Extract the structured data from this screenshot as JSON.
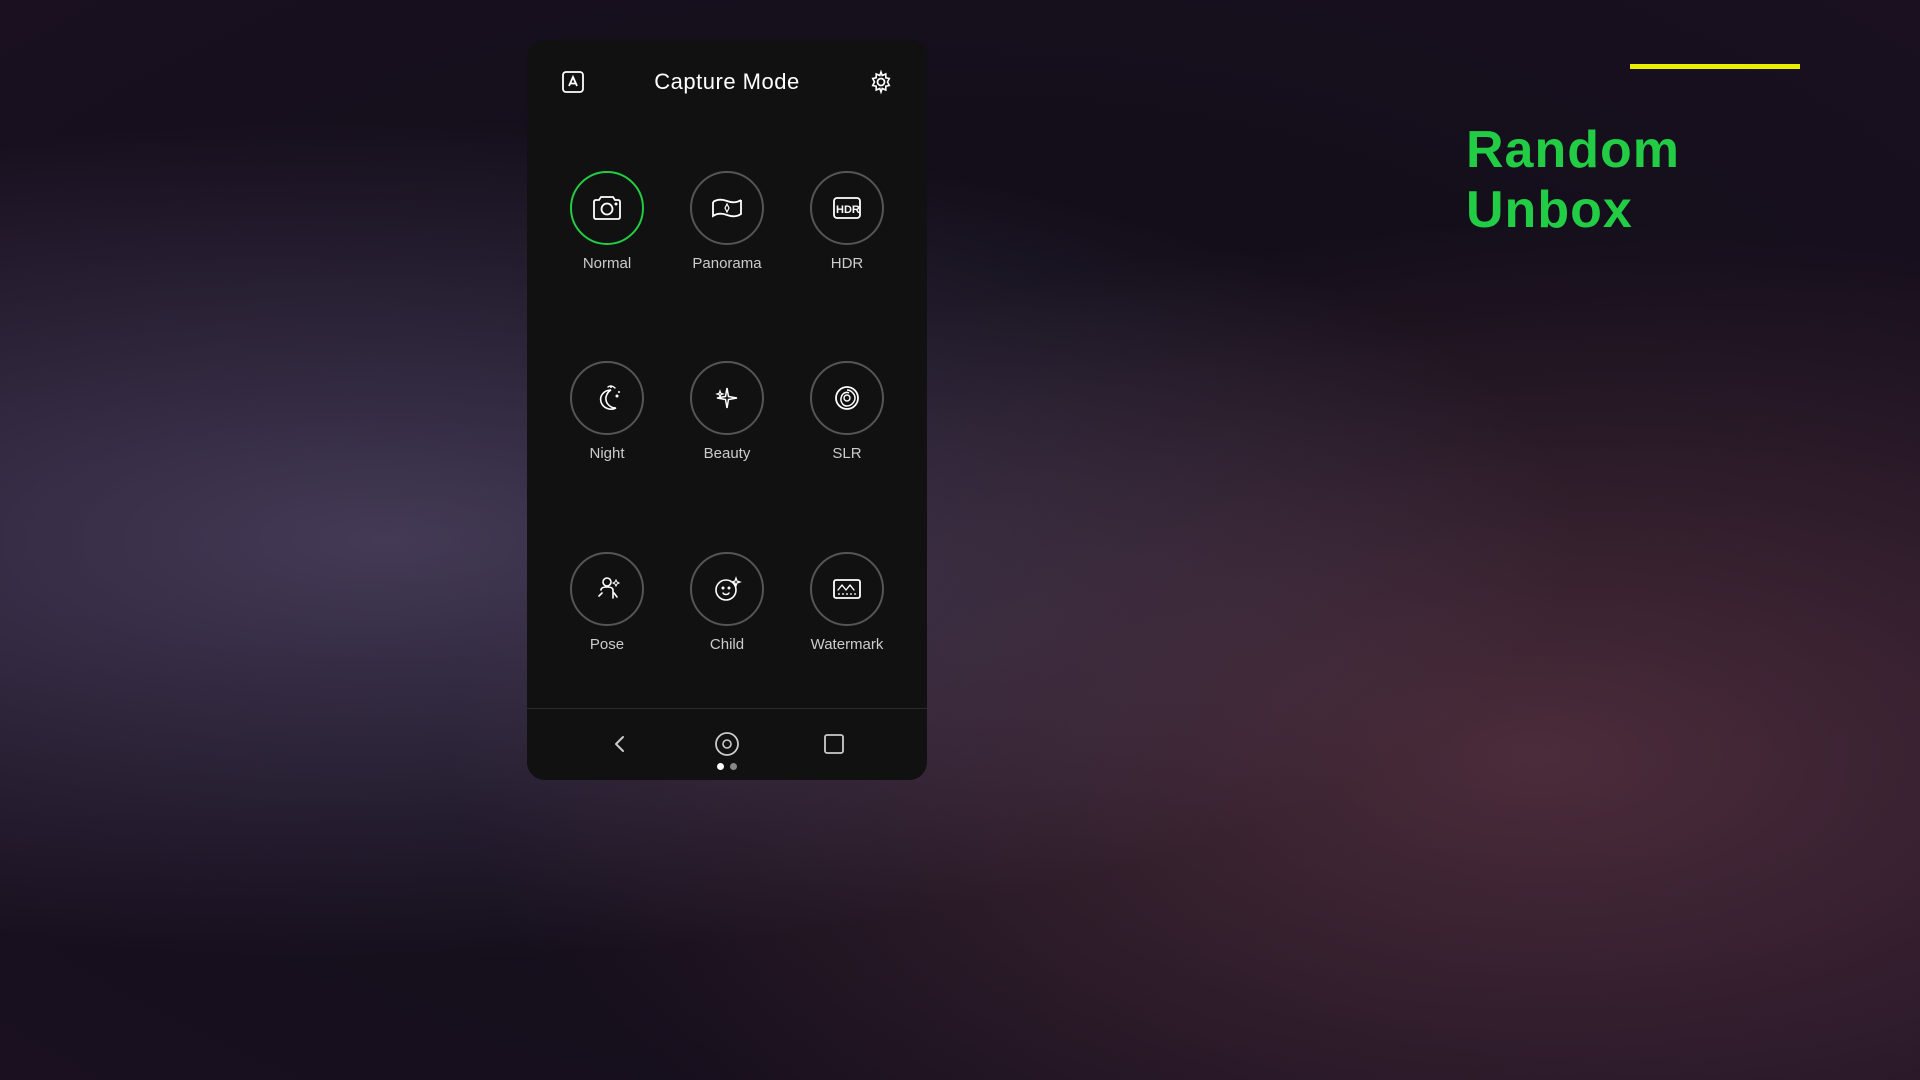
{
  "background": {
    "description": "dark purple-pink gradient background"
  },
  "brand": {
    "text_random": "Random",
    "text_unbox": " Unbox",
    "full": "Random Unbox",
    "underline_color": "#e8f000",
    "text_color": "#22cc44"
  },
  "header": {
    "title": "Capture Mode",
    "edit_icon": "edit-icon",
    "settings_icon": "settings-icon"
  },
  "modes": [
    {
      "id": "normal",
      "label": "Normal",
      "active": true,
      "icon": "camera-icon"
    },
    {
      "id": "panorama",
      "label": "Panorama",
      "active": false,
      "icon": "panorama-icon"
    },
    {
      "id": "hdr",
      "label": "HDR",
      "active": false,
      "icon": "hdr-icon"
    },
    {
      "id": "night",
      "label": "Night",
      "active": false,
      "icon": "night-icon"
    },
    {
      "id": "beauty",
      "label": "Beauty",
      "active": false,
      "icon": "beauty-icon"
    },
    {
      "id": "slr",
      "label": "SLR",
      "active": false,
      "icon": "slr-icon"
    },
    {
      "id": "pose",
      "label": "Pose",
      "active": false,
      "icon": "pose-icon"
    },
    {
      "id": "child",
      "label": "Child",
      "active": false,
      "icon": "child-icon"
    },
    {
      "id": "watermark",
      "label": "Watermark",
      "active": false,
      "icon": "watermark-icon"
    }
  ],
  "navbar": {
    "back_label": "back",
    "home_label": "home",
    "recents_label": "recents"
  }
}
